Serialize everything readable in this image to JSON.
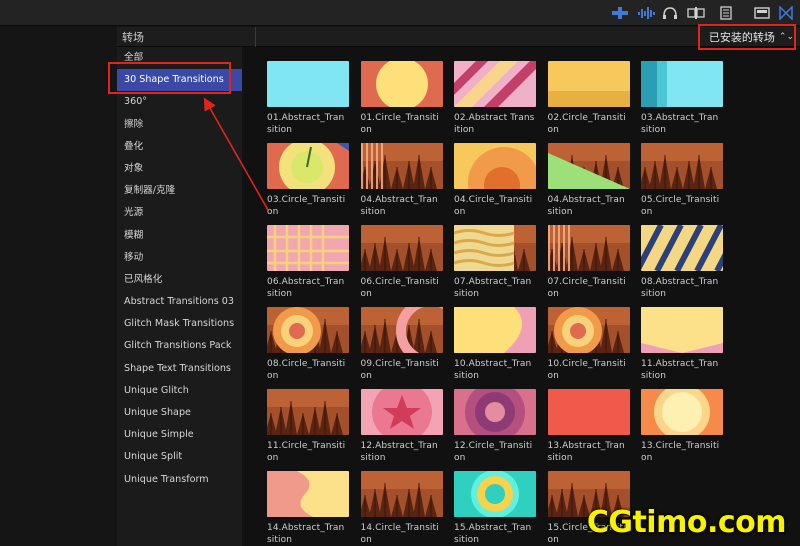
{
  "header": {
    "title": "转场",
    "dropdown_label": "已安装的转场"
  },
  "sidebar": {
    "items": [
      {
        "label": "全部"
      },
      {
        "label": "30 Shape Transitions"
      },
      {
        "label": "360°"
      },
      {
        "label": "擦除"
      },
      {
        "label": "叠化"
      },
      {
        "label": "对象"
      },
      {
        "label": "复制器/克隆"
      },
      {
        "label": "光源"
      },
      {
        "label": "模糊"
      },
      {
        "label": "移动"
      },
      {
        "label": "已风格化"
      },
      {
        "label": "Abstract Transitions 03"
      },
      {
        "label": "Glitch Mask Transitions"
      },
      {
        "label": "Glitch Transitions Pack"
      },
      {
        "label": "Shape Text Transitions"
      },
      {
        "label": "Unique Glitch"
      },
      {
        "label": "Unique Shape"
      },
      {
        "label": "Unique Simple"
      },
      {
        "label": "Unique Split"
      },
      {
        "label": "Unique Transform"
      }
    ],
    "selected_index": 1
  },
  "transitions": [
    {
      "label": "01.Abstract_Transition",
      "thumb": "cyan"
    },
    {
      "label": "01.Circle_Transition",
      "thumb": "bigcircle"
    },
    {
      "label": "02.Abstract Transition",
      "thumb": "diagonal"
    },
    {
      "label": "02.Circle_Transition",
      "thumb": "yellowhalf"
    },
    {
      "label": "03.Abstract_Transition",
      "thumb": "tealstripes"
    },
    {
      "label": "03.Circle_Transition",
      "thumb": "clock"
    },
    {
      "label": "04.Abstract_Transition",
      "thumb": "forestbars"
    },
    {
      "label": "04.Circle_Transition",
      "thumb": "orangecircle"
    },
    {
      "label": "04.Abstract_Transition",
      "thumb": "greentri"
    },
    {
      "label": "05.Circle_Transition",
      "thumb": "forest"
    },
    {
      "label": "06.Abstract_Transition",
      "thumb": "pinkgrid"
    },
    {
      "label": "06.Circle_Transition",
      "thumb": "forest"
    },
    {
      "label": "07.Abstract_Transition",
      "thumb": "waves"
    },
    {
      "label": "07.Circle_Transition",
      "thumb": "forestbars"
    },
    {
      "label": "08.Abstract_Transition",
      "thumb": "navystripes"
    },
    {
      "label": "08.Circle_Transition",
      "thumb": "rings"
    },
    {
      "label": "09.Circle_Transition",
      "thumb": "forestarc"
    },
    {
      "label": "10.Abstract_Transition",
      "thumb": "yellowblob"
    },
    {
      "label": "10.Circle_Transition",
      "thumb": "rings"
    },
    {
      "label": "11.Abstract_Transition",
      "thumb": "pinkbanner"
    },
    {
      "label": "11.Circle_Transition",
      "thumb": "forest"
    },
    {
      "label": "12.Abstract_Transition",
      "thumb": "star"
    },
    {
      "label": "12.Circle_Transition",
      "thumb": "purplerings"
    },
    {
      "label": "13.Abstract_Transition",
      "thumb": "redblock"
    },
    {
      "label": "13.Circle_Transition",
      "thumb": "sun"
    },
    {
      "label": "14.Abstract_Transition",
      "thumb": "pinkhalf"
    },
    {
      "label": "14.Circle_Transition",
      "thumb": "forest"
    },
    {
      "label": "15.Abstract_Transition",
      "thumb": "cyanring"
    },
    {
      "label": "15.Circle_Transition",
      "thumb": "forest"
    }
  ],
  "watermark": "CGtimo.com"
}
